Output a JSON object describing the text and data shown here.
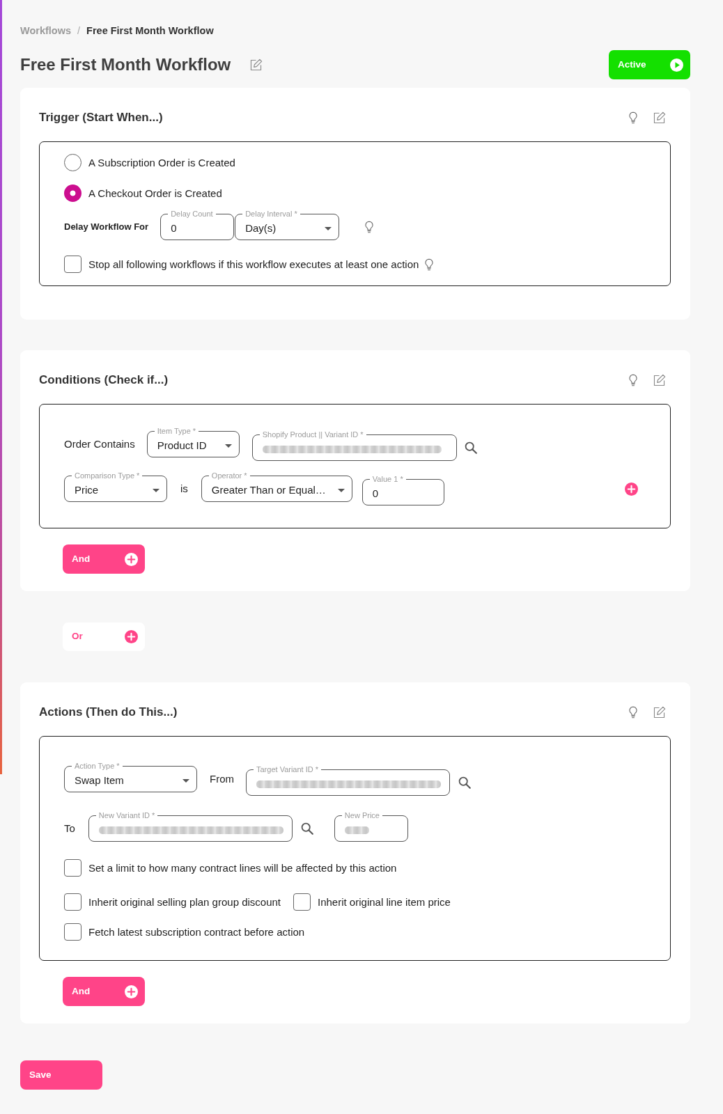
{
  "breadcrumb": {
    "items": [
      {
        "label": "Workflows",
        "current": false
      },
      {
        "label": "Free First Month Workflow",
        "current": true
      }
    ],
    "separator": "/"
  },
  "header": {
    "title": "Free First Month Workflow",
    "status_button": {
      "label": "Active",
      "active": true
    }
  },
  "trigger": {
    "title": "Trigger (Start When...)",
    "options": [
      {
        "label": "A Subscription Order is Created",
        "selected": false
      },
      {
        "label": "A Checkout Order is Created",
        "selected": true
      }
    ],
    "rows": [
      [
        {
          "kind": "label",
          "text": "Delay Workflow For"
        },
        {
          "kind": "input",
          "label": "Delay Count",
          "value": "0"
        },
        {
          "kind": "select",
          "label": "Delay Interval *",
          "value": "Day(s)"
        },
        {
          "kind": "hint"
        }
      ]
    ],
    "checks": [
      [
        {
          "label": "Stop all following workflows if this workflow executes at least one action",
          "checked": false,
          "hint": true
        }
      ]
    ]
  },
  "conditions": {
    "title": "Conditions (Check if...)",
    "rows": [
      [
        {
          "kind": "text",
          "text": "Order Contains"
        },
        {
          "kind": "select",
          "label": "Item Type *",
          "value": "Product ID"
        },
        {
          "kind": "input",
          "label": "Shopify Product || Variant ID *",
          "blurred": true
        },
        {
          "kind": "search"
        }
      ],
      [
        {
          "kind": "select",
          "label": "Comparison Type *",
          "value": "Price"
        },
        {
          "kind": "text",
          "text": "is"
        },
        {
          "kind": "select",
          "label": "Operator *",
          "value": "Greater Than or Equal…"
        },
        {
          "kind": "input",
          "label": "Value 1 *",
          "value": "0"
        },
        {
          "kind": "add"
        }
      ]
    ],
    "and_button": {
      "label": "And"
    }
  },
  "or_button": {
    "label": "Or"
  },
  "actions": {
    "title": "Actions (Then do This...)",
    "rows": [
      [
        {
          "kind": "select",
          "label": "Action Type *",
          "value": "Swap Item"
        },
        {
          "kind": "text",
          "text": "From"
        },
        {
          "kind": "input",
          "label": "Target Variant ID *",
          "blurred": true
        },
        {
          "kind": "search"
        }
      ],
      [
        {
          "kind": "text",
          "text": "To"
        },
        {
          "kind": "input",
          "label": "New Variant ID *",
          "blurred": true
        },
        {
          "kind": "search"
        },
        {
          "kind": "input",
          "label": "New Price",
          "blurred": true
        }
      ]
    ],
    "checks": [
      [
        {
          "label": "Set a limit to how many contract lines will be affected by this action",
          "checked": false
        }
      ],
      [
        {
          "label": "Inherit original selling plan group discount",
          "checked": false
        },
        {
          "label": "Inherit original line item price",
          "checked": false
        }
      ],
      [
        {
          "label": "Fetch latest subscription contract before action",
          "checked": false
        }
      ]
    ],
    "and_button": {
      "label": "And"
    }
  },
  "save_button": {
    "label": "Save"
  }
}
